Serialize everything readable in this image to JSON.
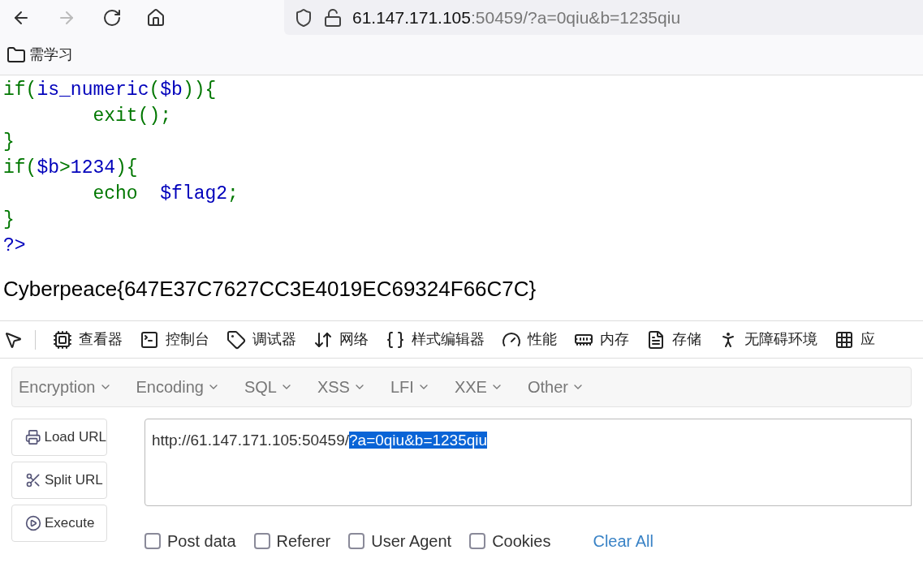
{
  "address_bar": {
    "host": "61.147.171.105",
    "rest": ":50459/?a=0qiu&b=1235qiu"
  },
  "bookmarks": [
    {
      "label": "需学习"
    }
  ],
  "source_lines": [
    [
      {
        "kind": "keyword",
        "text": "if("
      },
      {
        "kind": "default",
        "text": "is_numeric"
      },
      {
        "kind": "keyword",
        "text": "("
      },
      {
        "kind": "default",
        "text": "$b"
      },
      {
        "kind": "keyword",
        "text": ")){"
      }
    ],
    [
      {
        "kind": "keyword",
        "text": "        exit();"
      }
    ],
    [
      {
        "kind": "keyword",
        "text": "}"
      }
    ],
    [
      {
        "kind": "keyword",
        "text": "if("
      },
      {
        "kind": "default",
        "text": "$b"
      },
      {
        "kind": "keyword",
        "text": ">"
      },
      {
        "kind": "default",
        "text": "1234"
      },
      {
        "kind": "keyword",
        "text": "){"
      }
    ],
    [
      {
        "kind": "keyword",
        "text": "        echo  "
      },
      {
        "kind": "default",
        "text": "$flag2"
      },
      {
        "kind": "keyword",
        "text": ";"
      }
    ],
    [
      {
        "kind": "keyword",
        "text": "}"
      }
    ],
    [
      {
        "kind": "default",
        "text": "?>"
      }
    ]
  ],
  "output": "Cyberpeace{647E37C7627CC3E4019EC69324F66C7C}",
  "devtools_tabs": [
    {
      "label": "查看器"
    },
    {
      "label": "控制台"
    },
    {
      "label": "调试器"
    },
    {
      "label": "网络"
    },
    {
      "label": "样式编辑器"
    },
    {
      "label": "性能"
    },
    {
      "label": "内存"
    },
    {
      "label": "存储"
    },
    {
      "label": "无障碍环境"
    },
    {
      "label": "应"
    }
  ],
  "hackbar": {
    "menus": [
      "Encryption",
      "Encoding",
      "SQL",
      "XSS",
      "LFI",
      "XXE",
      "Other"
    ],
    "buttons": [
      "Load URL",
      "Split URL",
      "Execute"
    ],
    "url_parts": [
      {
        "text": "http://61.147.171.105:50459/",
        "selected": false
      },
      {
        "text": "?a=0qiu&b=1235qiu",
        "selected": true
      }
    ],
    "options": [
      {
        "label": "Post data",
        "checked": false
      },
      {
        "label": "Referer",
        "checked": false
      },
      {
        "label": "User Agent",
        "checked": false
      },
      {
        "label": "Cookies",
        "checked": false
      }
    ],
    "clear": "Clear All"
  }
}
